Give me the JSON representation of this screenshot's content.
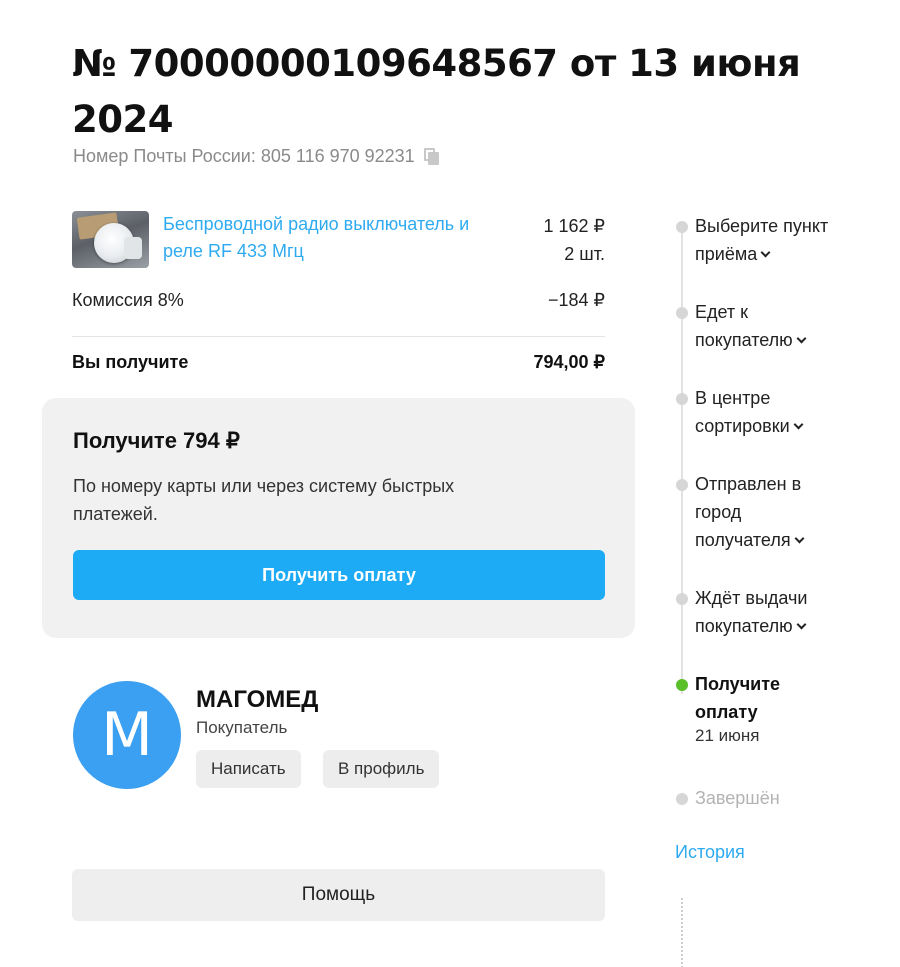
{
  "order": {
    "title": "№ 70000000109648567 от 13 июня 2024",
    "tracking_label": "Номер Почты России: 805 116 970 92231"
  },
  "product": {
    "name": "Беспроводной радио выключатель и реле RF 433 Мгц",
    "price": "1 162 ₽",
    "quantity": "2 шт."
  },
  "summary": {
    "commission_label": "Комиссия 8%",
    "commission_value": "−184 ₽",
    "total_label": "Вы получите",
    "total_value": "794,00 ₽"
  },
  "payout": {
    "title": "Получите 794 ₽",
    "description": "По номеру карты или через систему быстрых платежей.",
    "button_label": "Получить оплату",
    "button_color": "#1eabf5"
  },
  "buyer": {
    "initial": "М",
    "name": "МАГОМЕД",
    "role": "Покупатель",
    "write_label": "Написать",
    "profile_label": "В профиль",
    "avatar_color": "#3b9ff2"
  },
  "help_label": "Помощь",
  "timeline": {
    "steps": [
      {
        "label": "Выберите пункт приёма"
      },
      {
        "label": "Едет к покупателю"
      },
      {
        "label": "В центре сортировки"
      },
      {
        "label": "Отправлен в город получателя"
      },
      {
        "label": "Ждёт выдачи покупателю"
      },
      {
        "label": "Получите оплату",
        "date": "21 июня"
      },
      {
        "label": "Завершён"
      }
    ],
    "active_color": "#5bbf2a",
    "history_label": "История"
  },
  "colors": {
    "link": "#2eaaf0",
    "card_background": "#f1f1f1"
  },
  "icons": {
    "copy": "copy-icon",
    "chevron": "chevron-down-icon"
  }
}
